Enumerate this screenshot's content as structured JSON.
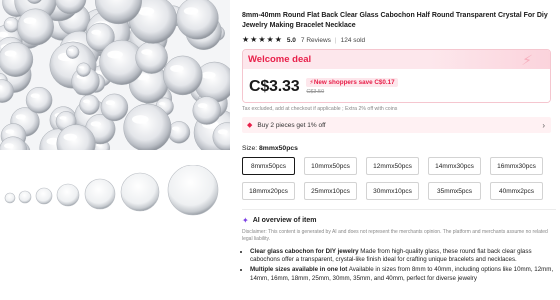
{
  "product": {
    "title": "8mm-40mm Round Flat Back Clear Glass Cabochon Half Round Transparent Crystal For Diy Jewelry Making Bracelet Necklace",
    "rating": "5.0",
    "reviews": "7 Reviews",
    "separator": "|",
    "sold": "124 sold",
    "star_count": 5
  },
  "deal": {
    "label": "Welcome deal",
    "price": "C$3.33",
    "promo": "New shoppers save C$0.17",
    "original_price": "C$3.50",
    "tax_note": "Tax excluded, add at checkout if applicable ; Extra 2% off with coins"
  },
  "bundle": {
    "text": "Buy 2 pieces get 1% off"
  },
  "size": {
    "label": "Size: ",
    "selected": "8mmx50pcs",
    "options": [
      "8mmx50pcs",
      "10mmx50pcs",
      "12mmx50pcs",
      "14mmx30pcs",
      "16mmx30pcs",
      "18mmx20pcs",
      "25mmx10pcs",
      "30mmx10pcs",
      "35mmx5pcs",
      "40mmx2pcs"
    ]
  },
  "ai": {
    "title": "AI overview of item",
    "disclaimer": "Disclaimer: This content is generated by AI and does not represent the merchants opinion. The platform and merchants assume no related legal liability.",
    "bullets": [
      {
        "bold": "Clear glass cabochon for DIY jewelry",
        "text": " Made from high-quality glass, these round flat back clear glass cabochons offer a transparent, crystal-like finish ideal for crafting unique bracelets and necklaces."
      },
      {
        "bold": "Multiple sizes available in one lot",
        "text": " Available in sizes from 8mm to 40mm, including options like 10mm, 12mm, 14mm, 16mm, 18mm, 25mm, 30mm, 35mm, and 40mm, perfect for diverse jewelry"
      }
    ]
  },
  "colors": {
    "accent": "#e8204a",
    "deal_bg": "#fde7ec",
    "ai_icon": "#7b3fe4"
  }
}
